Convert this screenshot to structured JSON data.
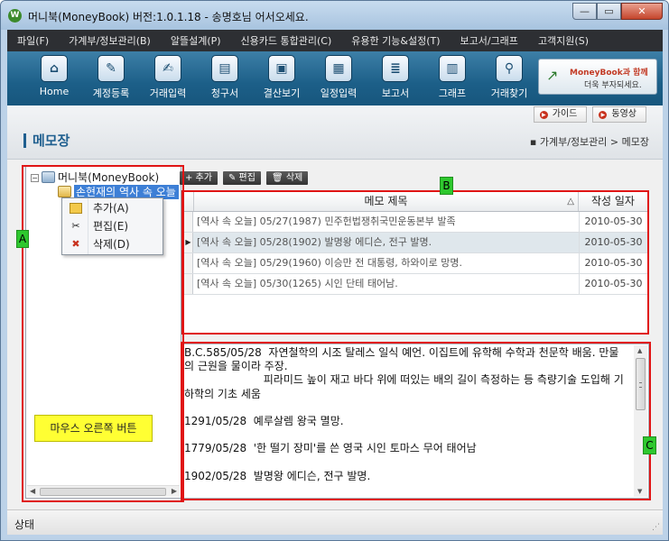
{
  "window": {
    "title": "머니북(MoneyBook) 버전:1.0.1.18 - 송명호님 어서오세요.",
    "app_icon": "W",
    "buttons": {
      "minimize": "—",
      "maximize": "▭",
      "close": "✕"
    }
  },
  "menubar": [
    "파일(F)",
    "가계부/정보관리(B)",
    "알뜰설계(P)",
    "신용카드 통합관리(C)",
    "유용한 기능&설정(T)",
    "보고서/그래프",
    "고객지원(S)"
  ],
  "toolbar": [
    {
      "label": "Home",
      "icon": "home-icon",
      "glyph": "⌂"
    },
    {
      "label": "계정등록",
      "icon": "account-register-icon",
      "glyph": "✎"
    },
    {
      "label": "거래입력",
      "icon": "transaction-input-icon",
      "glyph": "✍"
    },
    {
      "label": "청구서",
      "icon": "card-bill-icon",
      "glyph": "▤"
    },
    {
      "label": "결산보기",
      "icon": "settlement-monitor-icon",
      "glyph": "▣"
    },
    {
      "label": "일정입력",
      "icon": "calendar-icon",
      "glyph": "▦"
    },
    {
      "label": "보고서",
      "icon": "report-icon",
      "glyph": "≣"
    },
    {
      "label": "그래프",
      "icon": "bar-graph-icon",
      "glyph": "▥"
    },
    {
      "label": "거래찾기",
      "icon": "search-icon",
      "glyph": "⚲"
    }
  ],
  "banner": {
    "line1": "MoneyBook과 함께",
    "line2": "더욱 부자되세요."
  },
  "subheader": {
    "guide_label": "가이드",
    "video_label": "동영상",
    "page_title": "메모장",
    "breadcrumb": "▪ 가계부/정보관리 > 메모장"
  },
  "tree": {
    "toggle": "−",
    "root_label": "머니북(MoneyBook)",
    "child_label": "손현재의 역사 속 오늘"
  },
  "context_menu": [
    {
      "label": "추가(A)",
      "icon": "folder-icon",
      "glyph": "📁"
    },
    {
      "label": "편집(E)",
      "icon": "edit-icon",
      "glyph": "✂"
    },
    {
      "label": "삭제(D)",
      "icon": "delete-icon",
      "glyph": "✖"
    }
  ],
  "note": "마우스 오른쪽 버튼",
  "actions": {
    "add": "+ 추가",
    "edit": "편집",
    "delete": "삭제"
  },
  "grid": {
    "columns": {
      "title": "메모 제목",
      "date": "작성 일자"
    },
    "sort_indicator": "△",
    "rows": [
      {
        "title": "[역사 속 오늘] 05/27(1987) 민주헌법쟁취국민운동본부 발족",
        "date": "2010-05-30",
        "selected": false,
        "marker": ""
      },
      {
        "title": "[역사 속 오늘] 05/28(1902) 발명왕 에디슨, 전구 발명.",
        "date": "2010-05-30",
        "selected": true,
        "marker": "▶"
      },
      {
        "title": "[역사 속 오늘] 05/29(1960) 이승만 전 대통령, 하와이로 망명.",
        "date": "2010-05-30",
        "selected": false,
        "marker": ""
      },
      {
        "title": "[역사 속 오늘] 05/30(1265) 시인 단테 태어남.",
        "date": "2010-05-30",
        "selected": false,
        "marker": ""
      }
    ]
  },
  "memo_body": "B.C.585/05/28  자연철학의 시조 탈레스 일식 예언. 이집트에 유학해 수학과 천문학 배움. 만물의 근원을 물이라 주장.\n                       피라미드 높이 재고 바다 위에 떠있는 배의 길이 측정하는 등 측량기술 도입해 기하학의 기초 세움\n\n1291/05/28  예루살렘 왕국 멸망.\n\n1779/05/28  '한 떨기 장미'를 쓴 영국 시인 토마스 무어 태어남\n\n1902/05/28  발명왕 에디슨, 전구 발명.",
  "annotations": {
    "a": "A",
    "b": "B",
    "c": "C"
  },
  "statusbar": {
    "text": "상태"
  },
  "colors": {
    "toolbar": "#1c5f88",
    "menubar": "#2d2f33",
    "accent": "#1f5f8f",
    "annotation": "#e01515",
    "label": "#2ec82e",
    "note": "#ffff33"
  }
}
